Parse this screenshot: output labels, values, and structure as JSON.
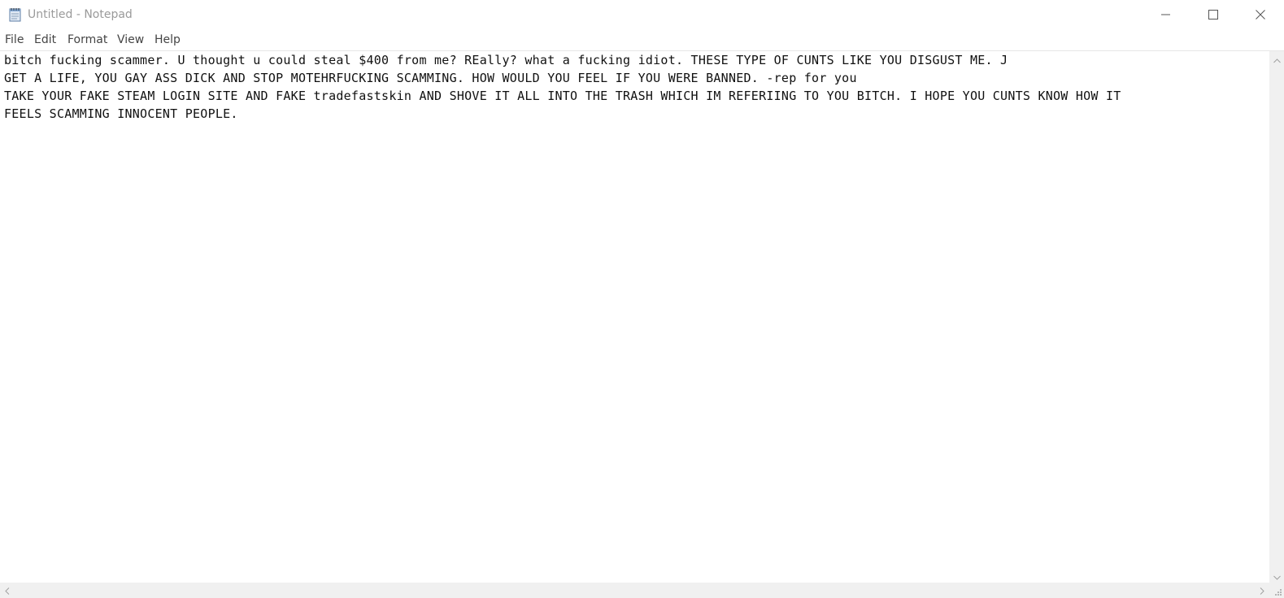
{
  "window": {
    "title": "Untitled - Notepad",
    "app_icon": "notepad-icon",
    "caption_buttons": [
      "minimize-icon",
      "maximize-icon",
      "close-icon"
    ]
  },
  "menu": {
    "items": [
      {
        "label": "File"
      },
      {
        "label": "Edit"
      },
      {
        "label": "Format"
      },
      {
        "label": "View"
      },
      {
        "label": "Help"
      }
    ]
  },
  "editor": {
    "lines": [
      "bitch fucking scammer. U thought u could steal $400 from me? REally? what a fucking idiot. THESE TYPE OF CUNTS LIKE YOU DISGUST ME. J",
      "GET A LIFE, YOU GAY ASS DICK AND STOP MOTEHRFUCKING SCAMMING. HOW WOULD YOU FEEL IF YOU WERE BANNED. -rep for you",
      "TAKE YOUR FAKE STEAM LOGIN SITE AND FAKE tradefastskin AND SHOVE IT ALL INTO THE TRASH WHICH IM REFERIING TO YOU BITCH. I HOPE YOU CUNTS KNOW HOW IT",
      "FEELS SCAMMING INNOCENT PEOPLE."
    ]
  },
  "scrollbars": {
    "vertical_icons": [
      "scroll-up-arrow-icon",
      "scroll-down-arrow-icon"
    ],
    "horizontal_icons": [
      "scroll-left-arrow-icon",
      "scroll-right-arrow-icon"
    ]
  },
  "colors": {
    "title_text": "#9a9a9a",
    "menu_text": "#444444",
    "editor_text": "#111111",
    "scrollbar_bg": "#f0f0f0"
  }
}
